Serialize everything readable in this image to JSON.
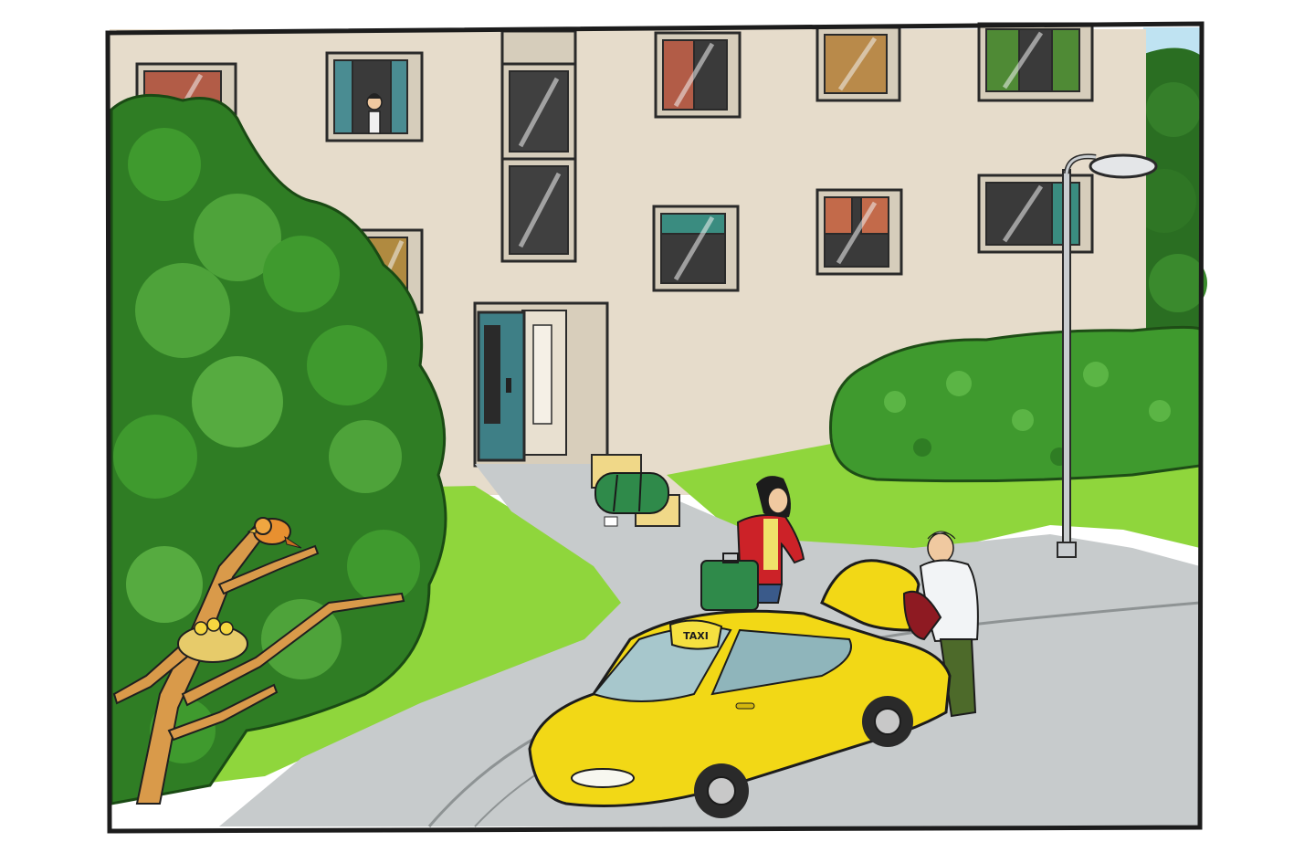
{
  "scene": {
    "kind": "cartoon illustration",
    "taxi_sign_text": "TAXI",
    "colors": {
      "frame": "#1c1c1c",
      "sky": "#bfe3f2",
      "building": "#e6dccb",
      "grass": "#8fd63c",
      "road": "#c7cbcc",
      "taxi_body": "#f2d816",
      "tree_dark": "#2f7d24",
      "tree_light": "#4ea33a",
      "hedge": "#3f9a2e",
      "door": "#3e7f86"
    },
    "objects": [
      "apartment-building",
      "tree",
      "bird",
      "nest",
      "hedge",
      "street-lamp",
      "taxi",
      "woman",
      "man",
      "boxes",
      "sleeping-bag",
      "suitcase"
    ]
  }
}
